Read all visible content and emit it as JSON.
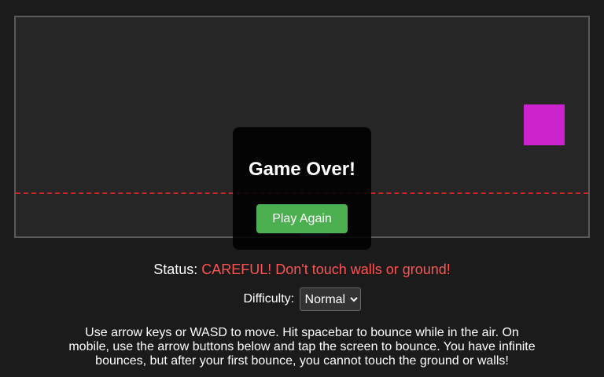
{
  "game": {
    "overlay_title": "Game Over!",
    "play_again_label": "Play Again"
  },
  "status": {
    "label": "Status:",
    "value": "CAREFUL! Don't touch walls or ground!"
  },
  "difficulty": {
    "label": "Difficulty:",
    "selected": "Normal"
  },
  "instructions": "Use arrow keys or WASD to move. Hit spacebar to bounce while in the air. On mobile, use the arrow buttons below and tap the screen to bounce. You have infinite bounces, but after your first bounce, you cannot touch the ground or walls!",
  "colors": {
    "background": "#1b1b1b",
    "game_area": "#262626",
    "danger_line": "#c62828",
    "obstacle": "#cc22cc",
    "player": "#1f6f8f",
    "play_again_button": "#4caf50",
    "status_value": "#ff5252"
  }
}
